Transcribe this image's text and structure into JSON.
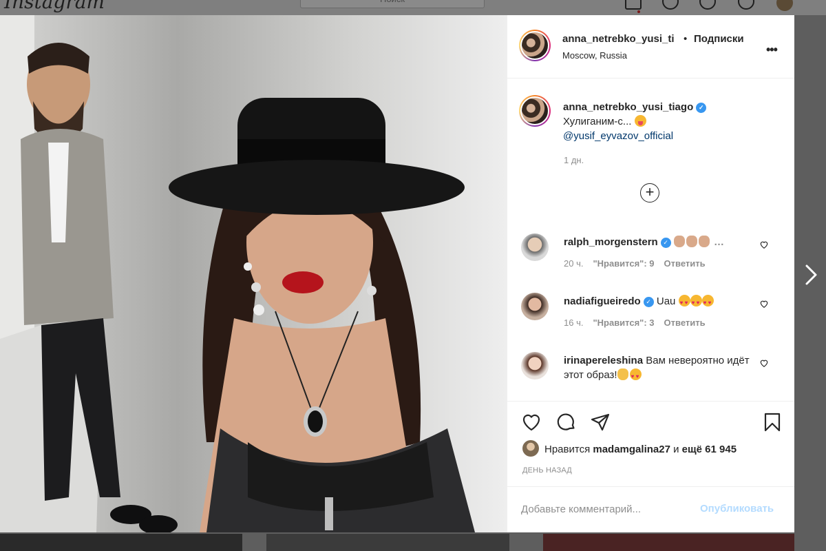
{
  "background_app": {
    "logo": "Instagram",
    "search_placeholder": "Поиск"
  },
  "post": {
    "header": {
      "username": "anna_netrebko_yusi_ti",
      "separator": "•",
      "follow_label": "Подписки",
      "location": "Moscow, Russia",
      "more_label": "•••"
    },
    "caption": {
      "username": "anna_netrebko_yusi_tiago",
      "text": "Хулиганим-с...",
      "mention": "@yusif_eyvazov_official",
      "time": "1 дн."
    },
    "load_more_label": "+",
    "comments": [
      {
        "username": "ralph_morgenstern",
        "text": "…",
        "time": "20 ч.",
        "likes": "\"Нравится\": 9",
        "reply": "Ответить"
      },
      {
        "username": "nadiafigueiredo",
        "text": "Uau",
        "time": "16 ч.",
        "likes": "\"Нравится\": 3",
        "reply": "Ответить"
      },
      {
        "username": "irinapereleshina",
        "text": "Вам невероятно идёт этот образ!"
      }
    ],
    "likes_row": {
      "prefix": "Нравится",
      "user": "madamgalina27",
      "middle": "и",
      "count": "ещё 61 945"
    },
    "date": "ДЕНЬ НАЗАД",
    "add_comment": {
      "placeholder": "Добавьте комментарий...",
      "publish_label": "Опубликовать"
    }
  },
  "colors": {
    "accent": "#3897f0",
    "link": "#00376b",
    "muted": "#8e8e8e",
    "text": "#262626",
    "publish_disabled": "#b3dbff"
  },
  "icons": [
    "verified-badge-icon",
    "heart-icon",
    "comment-icon",
    "share-icon",
    "bookmark-icon",
    "plus-circle-icon",
    "chevron-right-icon"
  ]
}
